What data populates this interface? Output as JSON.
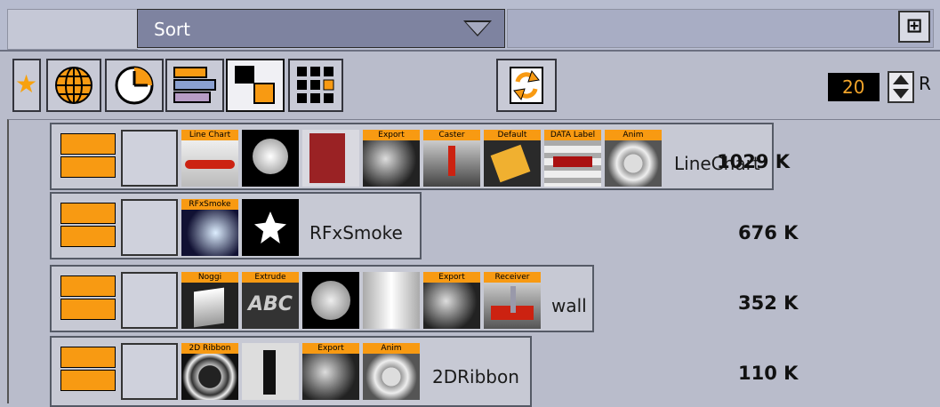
{
  "header": {
    "sort_label": "Sort"
  },
  "toolbar": {
    "page_count": "20",
    "r_label": "R"
  },
  "rows": [
    {
      "name": "LineChart",
      "size": "1029 K",
      "tiles": [
        "Line Chart",
        "",
        "",
        "Export",
        "Caster",
        "Default",
        "DATA Label",
        "Anim"
      ]
    },
    {
      "name": "RFxSmoke",
      "size": "676 K",
      "tiles": [
        "RFxSmoke",
        ""
      ]
    },
    {
      "name": "wall",
      "size": "352 K",
      "tiles": [
        "Noggi",
        "Extrude",
        "",
        "",
        "Export",
        "Receiver"
      ]
    },
    {
      "name": "2DRibbon",
      "size": "110 K",
      "tiles": [
        "2D Ribbon",
        "",
        "Export",
        "Anim"
      ]
    }
  ],
  "colors": {
    "accent": "#f89a12",
    "background": "#b9bccb",
    "dropdown": "#7e83a0"
  },
  "icons": [
    "star-icon",
    "globe-icon",
    "clock-icon",
    "bars-icon",
    "squares-icon",
    "grid-icon",
    "refresh-icon",
    "pin-icon"
  ]
}
